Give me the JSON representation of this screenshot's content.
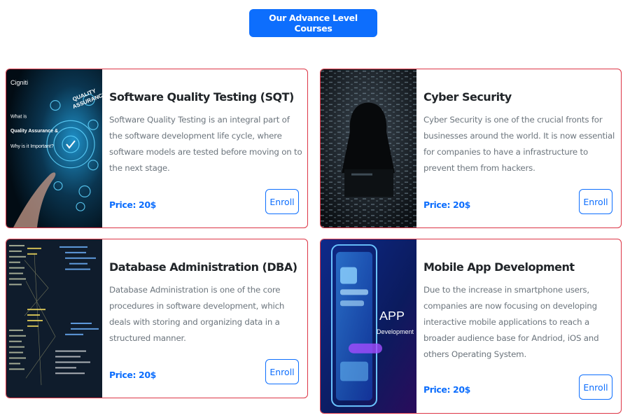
{
  "header": {
    "button_label": "Our Advance Level Courses"
  },
  "courses": [
    {
      "title": "Software Quality Testing (SQT)",
      "description": "Software Quality Testing is an integral part of the software development life cycle, where software models are tested before moving on to the next stage.",
      "price": "Price: 20$",
      "enroll_label": "Enroll",
      "image": {
        "brand": "Cigniti",
        "tagline": "What is",
        "headline": "Quality Assurance &",
        "subline": "Why is it Important?",
        "badge_line1": "QUALITY",
        "badge_line2": "ASSURANCE"
      }
    },
    {
      "title": "Cyber Security",
      "description": "Cyber Security is one of the crucial fronts for businesses around the world. It is now essential for companies to have a infrastructure to prevent them from hackers.",
      "price": "Price: 20$",
      "enroll_label": "Enroll"
    },
    {
      "title": "Database Administration (DBA)",
      "description": "Database Administration is one of the core procedures in software development, which deals with storing and organizing data in a structured manner.",
      "price": "Price: 20$",
      "enroll_label": "Enroll"
    },
    {
      "title": "Mobile App Development",
      "description": "Due to the increase in smartphone users, companies are now focusing on developing interactive mobile applications to reach a broader audience base for Andriod, iOS and others Operating System.",
      "price": "Price: 20$",
      "enroll_label": "Enroll",
      "image": {
        "line1": "APP",
        "line2": "Development"
      }
    }
  ],
  "colors": {
    "primary": "#0d6efd",
    "card_border": "#dc3545",
    "text_dark": "#212529",
    "text_muted": "#6c757d"
  }
}
